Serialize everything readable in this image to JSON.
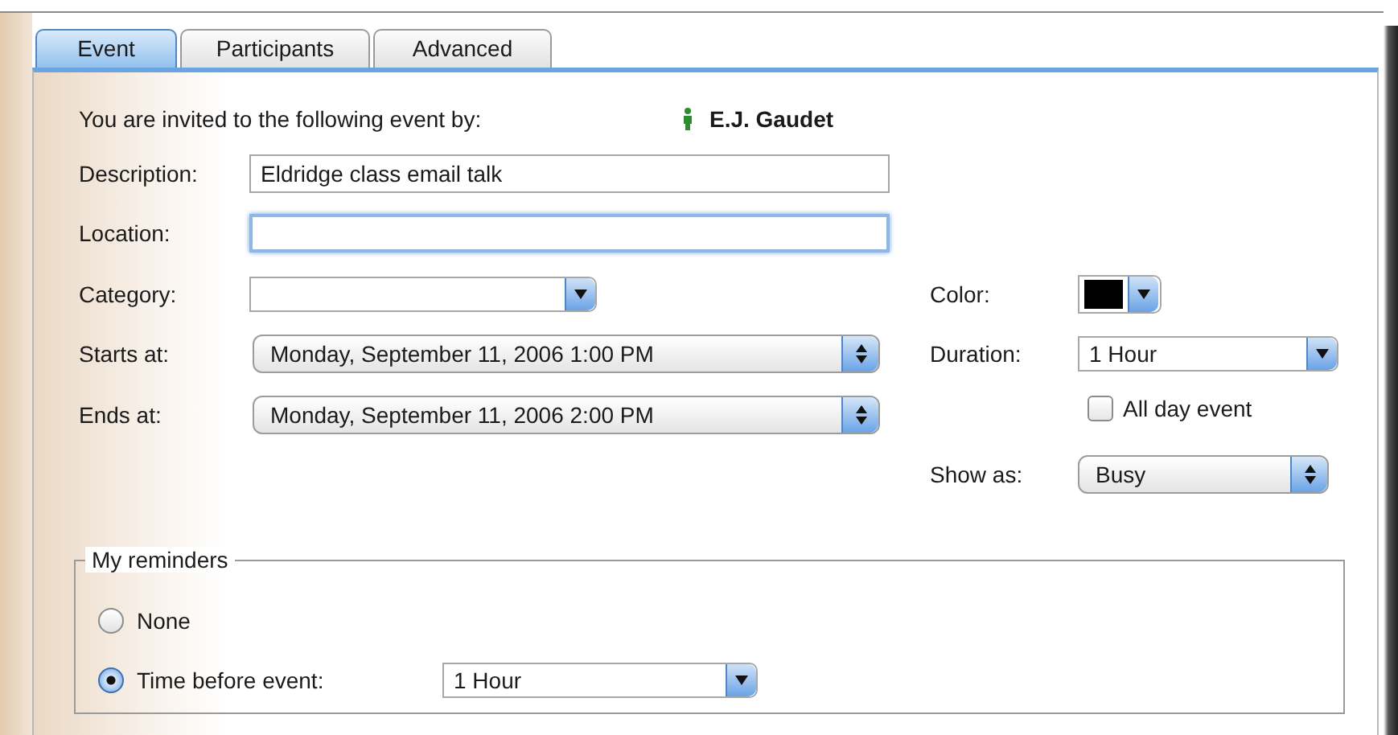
{
  "tabs": [
    {
      "label": "Event",
      "selected": true
    },
    {
      "label": "Participants",
      "selected": false
    },
    {
      "label": "Advanced",
      "selected": false
    }
  ],
  "invitation": {
    "text": "You are invited to the following event by:",
    "organizer": "E.J. Gaudet"
  },
  "fields": [
    {
      "label": "Description:",
      "kind": "text",
      "value": "Eldridge class email talk",
      "focused": false
    },
    {
      "label": "Location:",
      "kind": "text",
      "focused": true
    },
    {
      "label": "Category:",
      "kind": "combo"
    },
    {
      "label": "Starts at:",
      "kind": "popup",
      "value": "Monday, September 11, 2006 1:00 PM"
    },
    {
      "label": "Ends at:",
      "kind": "popup",
      "value": "Monday, September 11, 2006 2:00 PM"
    }
  ],
  "side_fields": [
    {
      "label": "Color:",
      "kind": "color",
      "color": "#000000"
    },
    {
      "label": "Duration:",
      "kind": "combo",
      "value": "1 Hour"
    },
    {
      "label": "All day event",
      "kind": "checkbox",
      "checked": false
    },
    {
      "label": "Show as:",
      "kind": "popup",
      "value": "Busy"
    }
  ],
  "reminders": {
    "title": "My reminders",
    "options": [
      {
        "label": "None",
        "selected": false
      },
      {
        "label": "Time before event:",
        "selected": true,
        "value": "1 Hour"
      }
    ]
  }
}
